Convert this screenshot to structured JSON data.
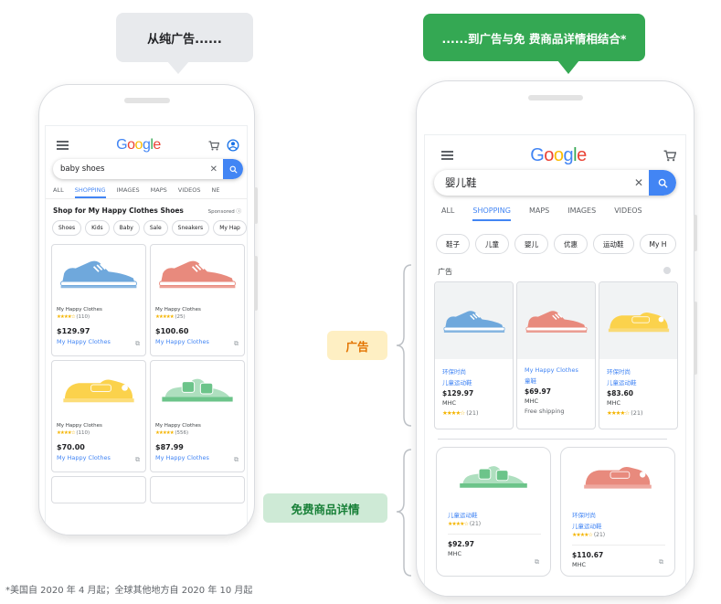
{
  "bubbles": {
    "left": "从纯广告......",
    "right": "......到广告与免 费商品详情相结合*"
  },
  "left_phone": {
    "search_query": "baby shoes",
    "tabs": [
      "ALL",
      "SHOPPING",
      "IMAGES",
      "MAPS",
      "VIDEOS",
      "NE"
    ],
    "active_tab": "SHOPPING",
    "ad_title": "Shop for My Happy Clothes Shoes",
    "sponsored": "Sponsored ⓘ",
    "chips": [
      "Shoes",
      "Kids",
      "Baby",
      "Sale",
      "Sneakers",
      "My Hap"
    ],
    "cards": [
      {
        "name": "My Happy Clothes",
        "stars": "★★★★☆",
        "count": "(110)",
        "price": "$129.97",
        "merchant": "My Happy Clothes",
        "shoe": "blue-sneaker-icon"
      },
      {
        "name": "My Happy Clothes",
        "stars": "★★★★★",
        "count": "(25)",
        "price": "$100.60",
        "merchant": "My Happy Clothes",
        "shoe": "red-sneaker-icon"
      },
      {
        "name": "My Happy Clothes",
        "stars": "★★★★☆",
        "count": "(110)",
        "price": "$70.00",
        "merchant": "My Happy Clothes",
        "shoe": "yellow-shoe-icon"
      },
      {
        "name": "My Happy Clothes",
        "stars": "★★★★★",
        "count": "(556)",
        "price": "$87.99",
        "merchant": "My Happy Clothes",
        "shoe": "green-sandal-icon"
      }
    ]
  },
  "right_phone": {
    "search_query": "婴儿鞋",
    "tabs": [
      "ALL",
      "SHOPPING",
      "MAPS",
      "IMAGES",
      "VIDEOS"
    ],
    "active_tab": "SHOPPING",
    "chips": [
      "鞋子",
      "儿童",
      "婴儿",
      "优惠",
      "运动鞋",
      "My H"
    ],
    "ad_label": "广告",
    "ad_cards": [
      {
        "t1": "环保时尚",
        "t2": "儿童运动鞋",
        "price": "$129.97",
        "merchant": "MHC",
        "stars": "★★★★☆",
        "count": "(21)",
        "shoe": "blue-sneaker-icon"
      },
      {
        "t1": "My Happy Clothes",
        "t2": "童鞋",
        "price": "$69.97",
        "merchant": "MHC",
        "extra": "Free shipping",
        "shoe": "red-sneaker-icon"
      },
      {
        "t1": "环保时尚",
        "t2": "儿童运动鞋",
        "price": "$83.60",
        "merchant": "MHC",
        "stars": "★★★★☆",
        "count": "(21)",
        "shoe": "yellow-shoe-icon"
      }
    ],
    "free_cards": [
      {
        "t1": "",
        "t2": "儿童运动鞋",
        "stars": "★★★★☆",
        "count": "(21)",
        "price": "$92.97",
        "merchant": "MHC",
        "shoe": "green-sandal-icon"
      },
      {
        "t1": "环保时尚",
        "t2": "儿童运动鞋",
        "stars": "★★★★☆",
        "count": "(21)",
        "price": "$110.67",
        "merchant": "MHC",
        "shoe": "red-shoe-icon"
      }
    ]
  },
  "labels": {
    "ads": "广告",
    "free_listings": "免费商品详情"
  },
  "footnote": "*美国自 2020 年 4 月起；全球其他地方自 2020 年 10 月起",
  "colors": {
    "google_blue": "#4285f4",
    "green_accent": "#34a853",
    "ad_label_bg": "#feefc3",
    "ad_label_text": "#e37400",
    "free_label_bg": "#ceead6",
    "free_label_text": "#188038"
  }
}
